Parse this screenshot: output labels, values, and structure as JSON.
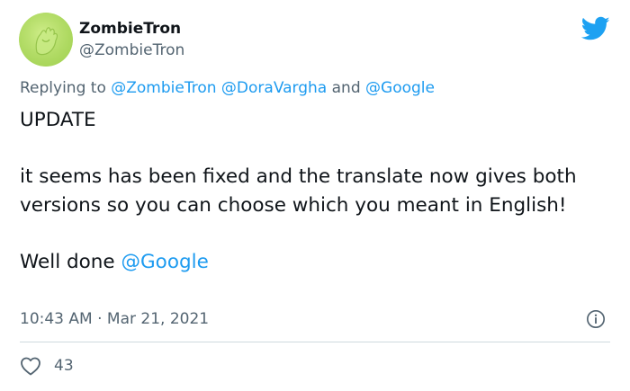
{
  "colors": {
    "text": "#0f1419",
    "muted": "#536471",
    "link": "#1d9bf0",
    "twitter_blue": "#1da1f2",
    "avatar_green": "#b6e06b",
    "divider": "#cfd9de"
  },
  "author": {
    "display_name": "ZombieTron",
    "handle": "@ZombieTron",
    "avatar_icon": "green-hand-avatar"
  },
  "logo_icon": "twitter-bird-icon",
  "reply": {
    "prefix": "Replying to",
    "mentions": [
      "@ZombieTron",
      "@DoraVargha",
      "@Google"
    ],
    "conjunction": "and"
  },
  "tweet": {
    "line_update": "UPDATE",
    "paragraph": "it seems has been fixed and the translate now gives both versions so you can choose which you meant in English!",
    "closing_text": "Well done",
    "closing_mention": "@Google"
  },
  "meta": {
    "time": "10:43 AM",
    "separator": "·",
    "date": "Mar 21, 2021",
    "info_icon": "info-icon"
  },
  "engagement": {
    "like_icon": "heart-icon",
    "like_count": "43"
  }
}
